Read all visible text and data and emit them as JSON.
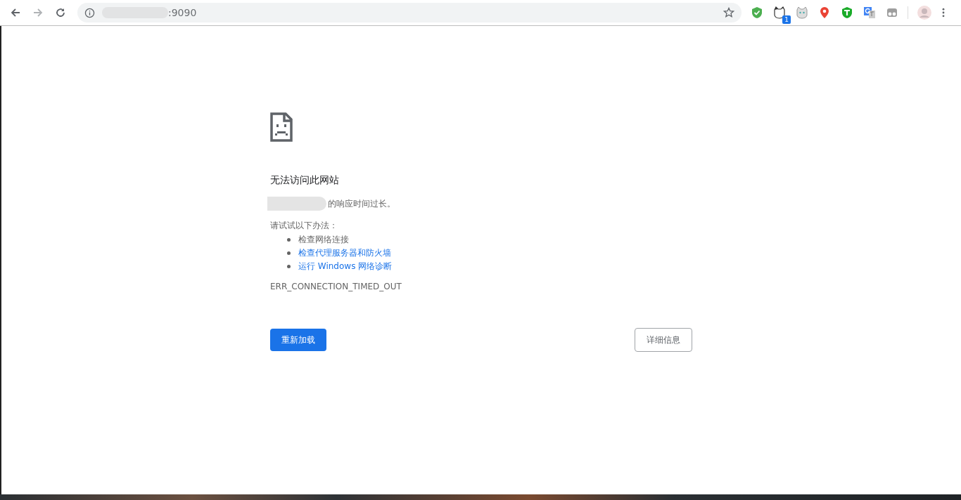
{
  "toolbar": {
    "address": {
      "text": ":9090"
    },
    "extensions": [
      {
        "kind": "shield",
        "color": "#4caf50"
      },
      {
        "kind": "cat",
        "badge": "1"
      },
      {
        "kind": "cat2"
      },
      {
        "kind": "pin",
        "color": "#ea4335"
      },
      {
        "kind": "tshield",
        "color": "#1aab29"
      },
      {
        "kind": "translate",
        "color": "#4285f4"
      },
      {
        "kind": "glasses",
        "color": "#9e9e9e"
      }
    ]
  },
  "error": {
    "title": "无法访问此网站",
    "message": "的响应时间过长。",
    "suggestions_heading": "请试试以下办法：",
    "suggestions": [
      {
        "text": "检查网络连接",
        "kind": "text"
      },
      {
        "text": "检查代理服务器和防火墙",
        "kind": "link"
      },
      {
        "text": "运行 Windows 网络诊断",
        "kind": "link"
      }
    ],
    "code": "ERR_CONNECTION_TIMED_OUT",
    "reload_button": "重新加载",
    "details_button": "详细信息"
  }
}
